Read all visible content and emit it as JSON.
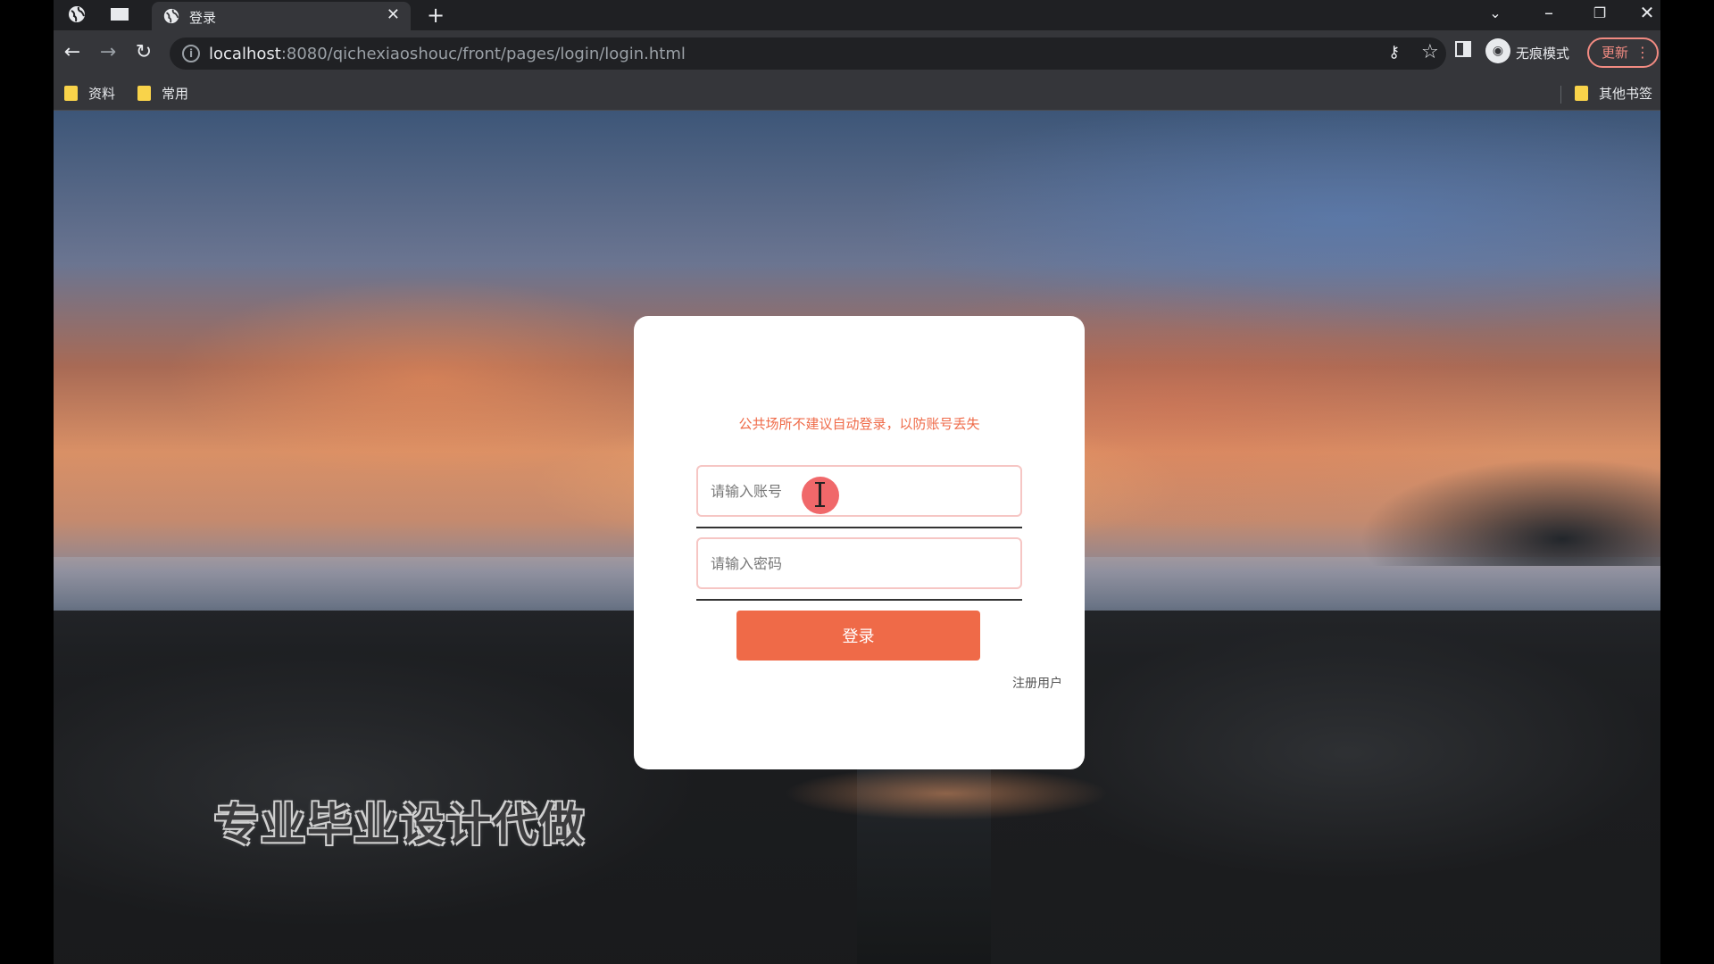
{
  "browser": {
    "tab": {
      "title": "登录"
    },
    "address": {
      "host": "localhost",
      "rest": ":8080/qichexiaoshouc/front/pages/login/login.html"
    },
    "profile_label": "无痕模式",
    "update_label": "更新",
    "bookmarks": [
      {
        "label": "资料"
      },
      {
        "label": "常用"
      }
    ],
    "other_bookmarks": "其他书签"
  },
  "login": {
    "notice": "公共场所不建议自动登录，以防账号丢失",
    "account_placeholder": "请输入账号",
    "account_value": "",
    "password_placeholder": "请输入密码",
    "password_value": "",
    "submit_label": "登录",
    "register_label": "注册用户"
  },
  "watermark": "专业毕业设计代做",
  "colors": {
    "accent": "#ef6a48",
    "field_border": "#f6c6c4",
    "update_border": "#f28b82",
    "cursor_marker": "#f0686a"
  }
}
